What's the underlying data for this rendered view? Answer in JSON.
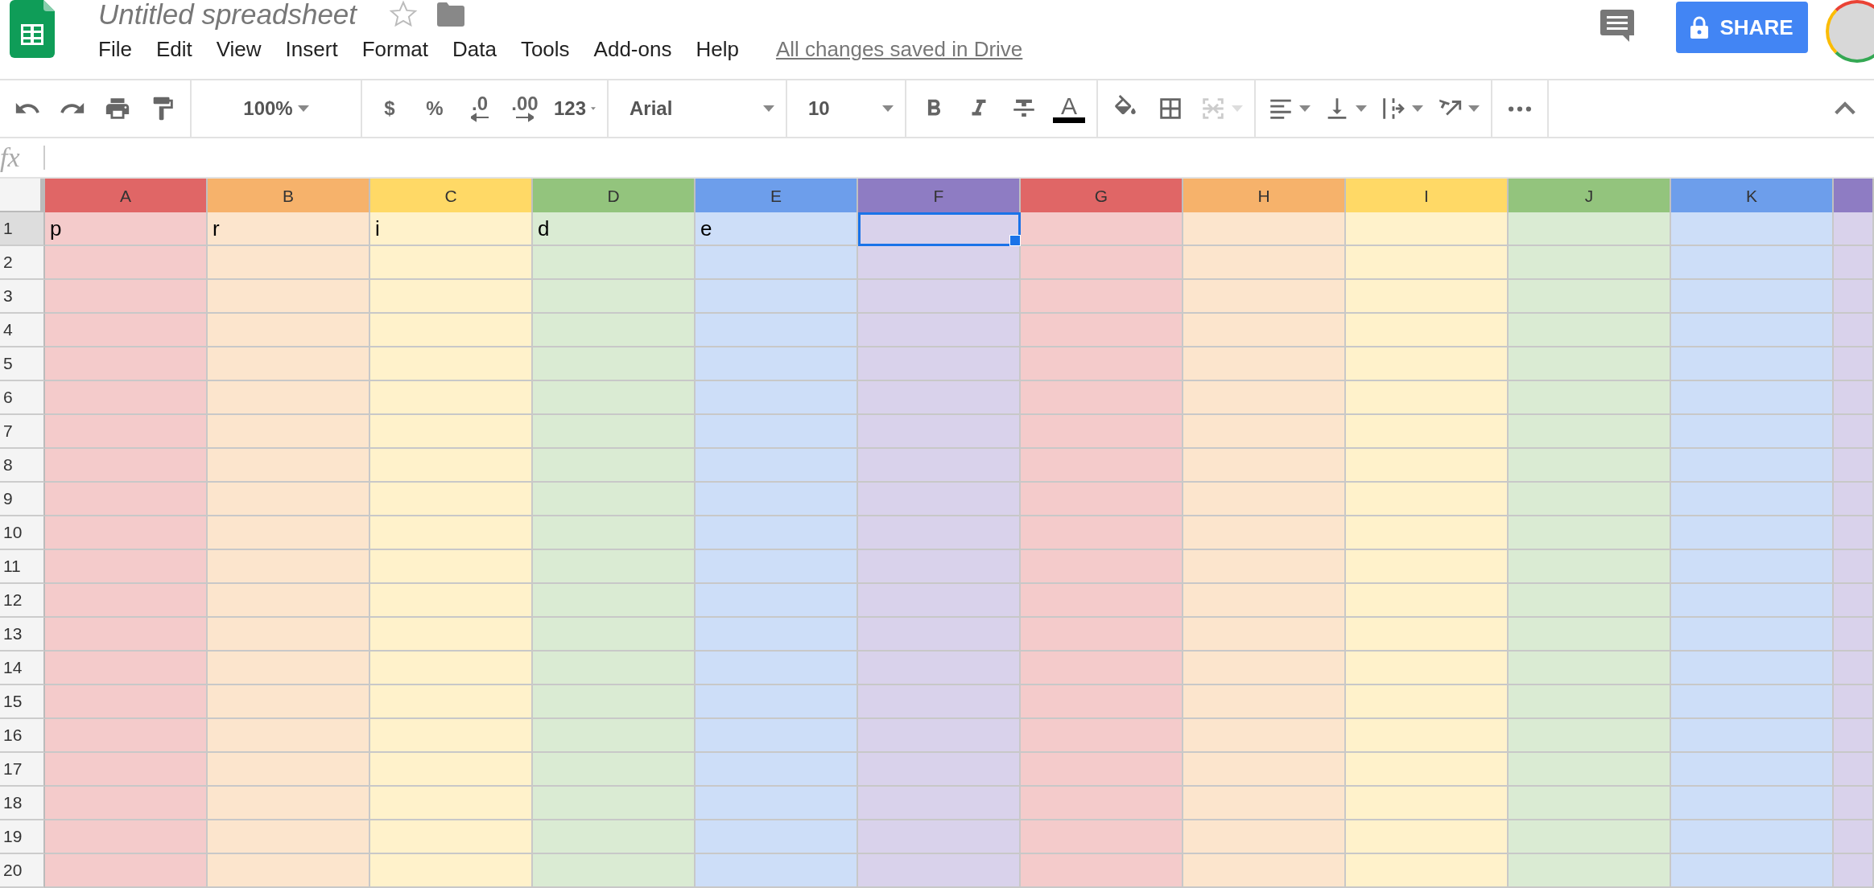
{
  "document": {
    "title": "Untitled spreadsheet",
    "save_status": "All changes saved in Drive"
  },
  "menu": [
    "File",
    "Edit",
    "View",
    "Insert",
    "Format",
    "Data",
    "Tools",
    "Add-ons",
    "Help"
  ],
  "share_button": {
    "label": "SHARE"
  },
  "toolbar": [
    [
      {
        "kind": "undo"
      },
      {
        "kind": "redo"
      },
      {
        "kind": "print"
      },
      {
        "kind": "paint-format"
      }
    ],
    [
      {
        "kind": "zoom",
        "text": "100%"
      }
    ],
    [
      {
        "kind": "text",
        "text": "$"
      },
      {
        "kind": "text",
        "text": "%"
      },
      {
        "kind": "decimal-less",
        "text": ".0"
      },
      {
        "kind": "decimal-more",
        "text": ".00"
      },
      {
        "kind": "number-format",
        "text": "123"
      }
    ],
    [
      {
        "kind": "font",
        "text": "Arial"
      }
    ],
    [
      {
        "kind": "font-size",
        "text": "10"
      }
    ],
    [
      {
        "kind": "bold"
      },
      {
        "kind": "italic"
      },
      {
        "kind": "strike"
      },
      {
        "kind": "text-color",
        "text": "A"
      }
    ],
    [
      {
        "kind": "fill"
      },
      {
        "kind": "borders"
      },
      {
        "kind": "merge",
        "disabled": true,
        "dropdown": true
      }
    ],
    [
      {
        "kind": "align",
        "dropdown": true
      },
      {
        "kind": "valign",
        "dropdown": true
      },
      {
        "kind": "wrap",
        "dropdown": true
      },
      {
        "kind": "rotate",
        "dropdown": true
      }
    ],
    [
      {
        "kind": "more"
      }
    ]
  ],
  "formula_bar": {
    "label": "fx"
  },
  "columns": [
    {
      "label": "A",
      "color": "#e06666"
    },
    {
      "label": "B",
      "color": "#f6b26b"
    },
    {
      "label": "C",
      "color": "#ffd966"
    },
    {
      "label": "D",
      "color": "#93c47d"
    },
    {
      "label": "E",
      "color": "#6d9eeb"
    },
    {
      "label": "F",
      "color": "#8e7cc3"
    },
    {
      "label": "G",
      "color": "#e06666"
    },
    {
      "label": "H",
      "color": "#f6b26b"
    },
    {
      "label": "I",
      "color": "#ffd966"
    },
    {
      "label": "J",
      "color": "#93c47d"
    },
    {
      "label": "K",
      "color": "#6d9eeb"
    },
    {
      "color": "#8e7cc3"
    }
  ],
  "rows": [
    {
      "label": "1",
      "cells": [
        {
          "text": "p",
          "selected": false
        },
        {
          "text": "r",
          "selected": false
        },
        {
          "text": "i",
          "selected": false
        },
        {
          "text": "d",
          "selected": false
        },
        {
          "text": "e",
          "selected": false
        },
        {
          "selected": true
        },
        {
          "selected": false
        },
        {
          "selected": false
        },
        {
          "selected": false
        },
        {
          "selected": false
        },
        {
          "selected": false
        },
        {
          "selected": false
        }
      ]
    },
    {
      "label": "2"
    },
    {
      "label": "3"
    },
    {
      "label": "4"
    },
    {
      "label": "5"
    },
    {
      "label": "6"
    },
    {
      "label": "7"
    },
    {
      "label": "8"
    },
    {
      "label": "9"
    },
    {
      "label": "10"
    },
    {
      "label": "11"
    },
    {
      "label": "12"
    },
    {
      "label": "13"
    },
    {
      "label": "14"
    },
    {
      "label": "15"
    },
    {
      "label": "16"
    },
    {
      "label": "17"
    },
    {
      "label": "18"
    },
    {
      "label": "19"
    },
    {
      "label": "20"
    }
  ]
}
